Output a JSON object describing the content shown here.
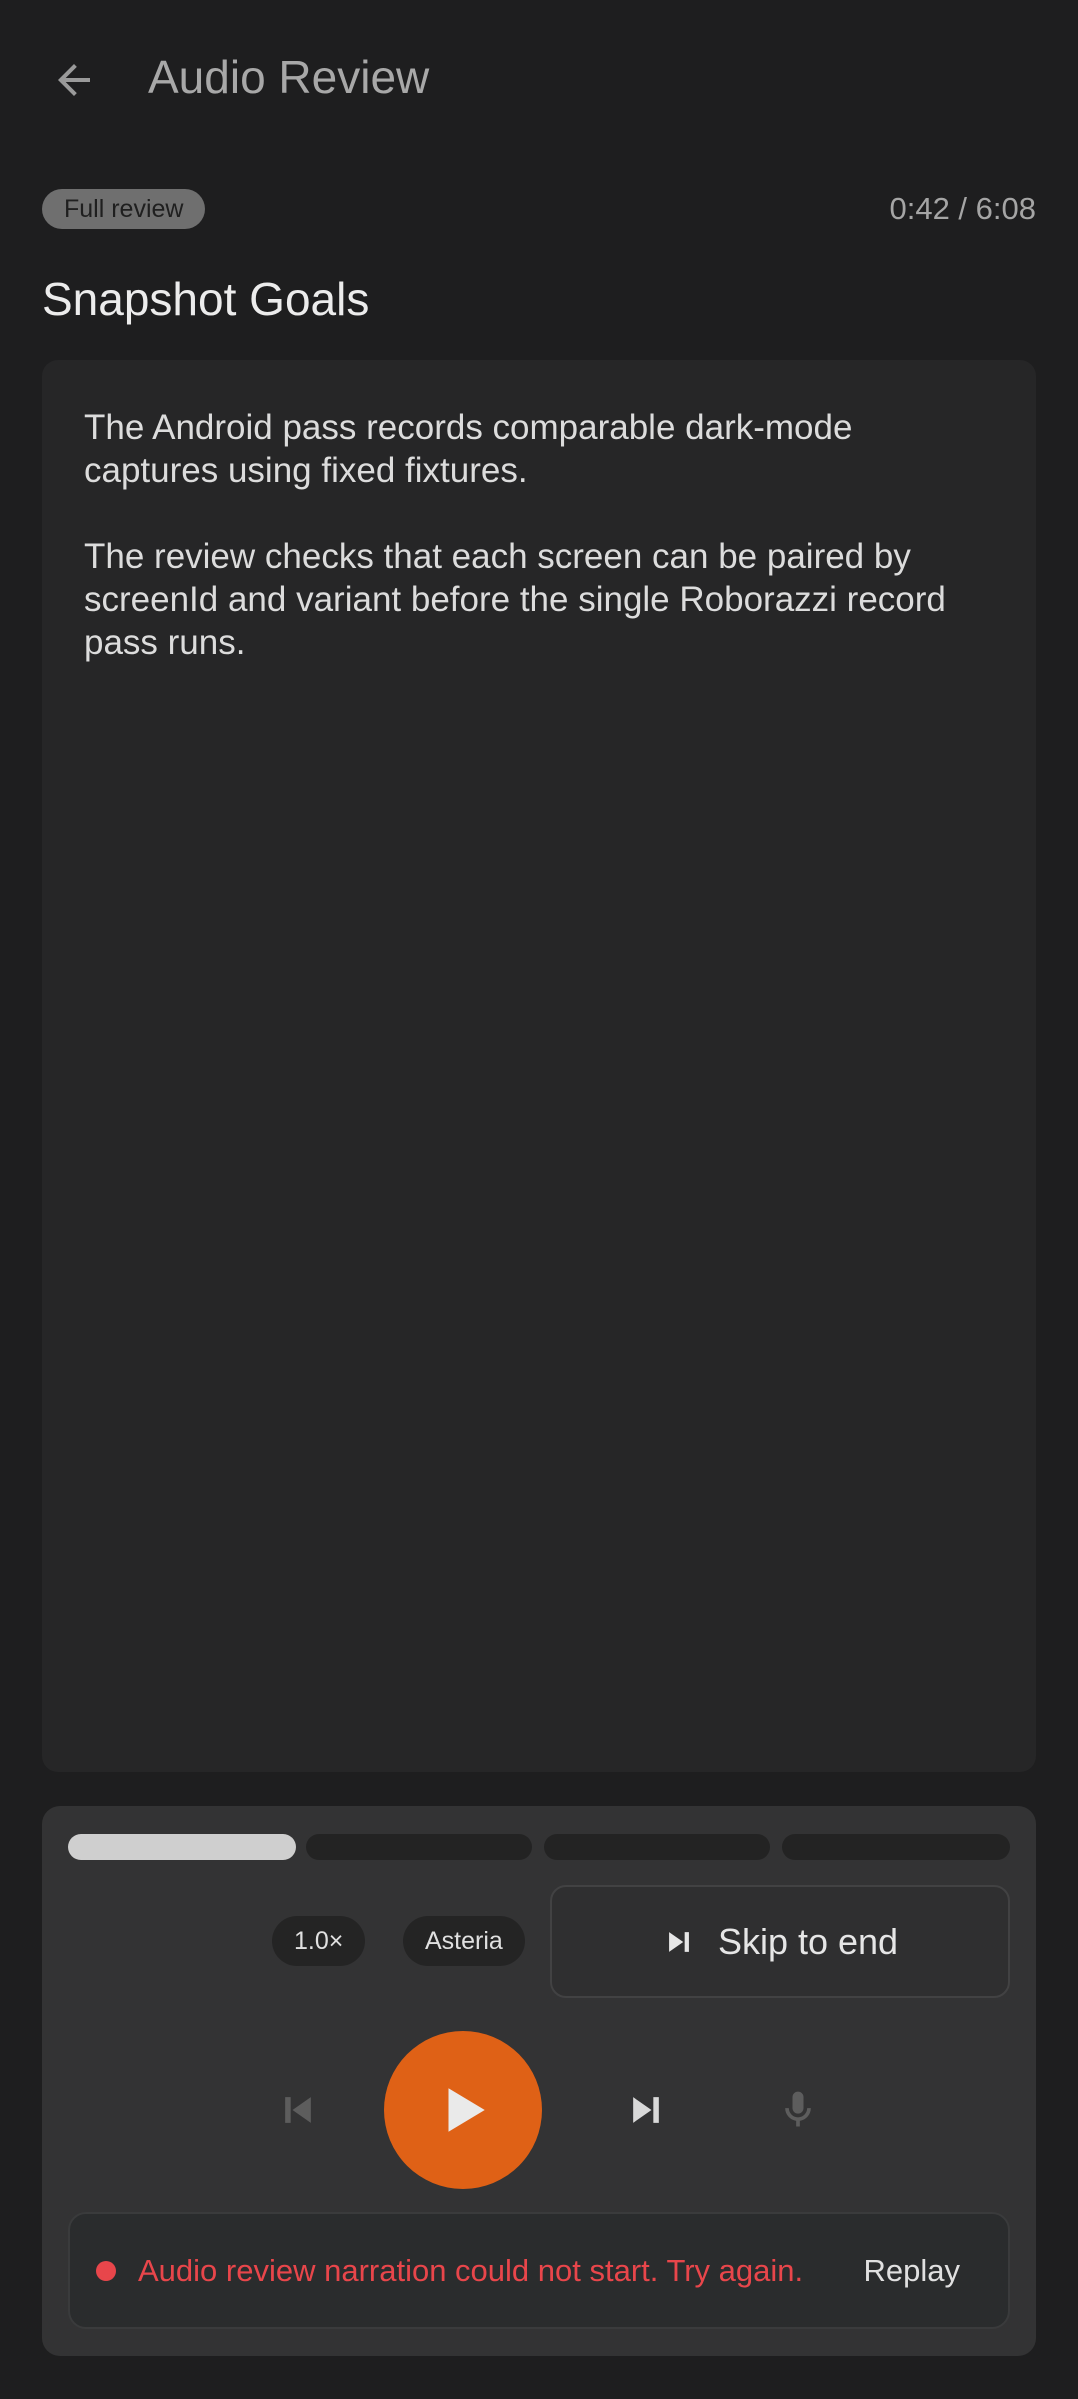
{
  "topbar": {
    "title": "Audio Review"
  },
  "meta": {
    "mode_chip": "Full review",
    "timecode": "0:42 / 6:08"
  },
  "section": {
    "title": "Snapshot Goals",
    "paragraphs": [
      "The Android pass records comparable dark-mode captures using fixed fixtures.",
      "The review checks that each screen can be paired by screenId and variant before the single Roborazzi record pass runs."
    ]
  },
  "player": {
    "segments_progress": [
      1.0,
      0.0,
      0.0,
      0.0
    ],
    "speed": "1.0×",
    "voice": "Asteria",
    "skip_label": "Skip to end",
    "controls": {
      "previous": "skip-previous-icon",
      "play": "play-icon",
      "next": "skip-next-icon",
      "mic": "microphone-icon"
    }
  },
  "error": {
    "message": "Audio review narration could not start. Try again.",
    "action": "Replay"
  },
  "colors": {
    "accent": "#df6116",
    "error": "#e8464b",
    "background": "#1e1e1f",
    "card": "#262627",
    "panel": "#333334"
  }
}
